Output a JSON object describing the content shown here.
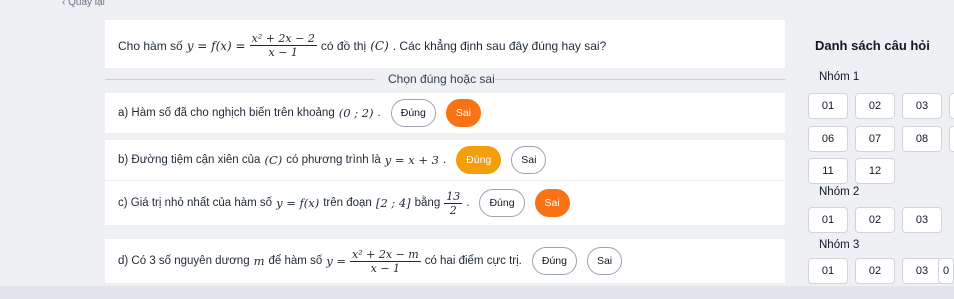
{
  "topbar": {
    "back_label": "Quay lại",
    "title": ""
  },
  "question": {
    "prefix": "Cho hàm số",
    "y_eq": "y = f(x) =",
    "frac_num": "x² + 2x − 2",
    "frac_den": "x − 1",
    "suffix": "có đồ thị",
    "graph": "(C)",
    "tail": ". Các khẳng định sau đây đúng hay sai?"
  },
  "instruction": "Chọn đúng hoặc sai",
  "statements": [
    {
      "text": "a) Hàm số đã cho nghịch biến trên khoảng",
      "math": "(0 ; 2)",
      "end": ".",
      "true_label": "Đúng",
      "false_label": "Sai",
      "selected": "Sai"
    },
    {
      "text": "b) Đường tiệm cận xiên của",
      "math": "(C)",
      "text2": "có phương trình là",
      "math2": "y = x + 3",
      "end": ".",
      "true_label": "Đúng",
      "false_label": "Sai",
      "selected": "Đúng"
    },
    {
      "text": "c) Giá trị nhỏ nhất của hàm số",
      "math": "y = f(x)",
      "text2": "trên đoạn",
      "math2": "[2 ; 4]",
      "text3": "bằng",
      "frac_num": "13",
      "frac_den": "2",
      "end": ".",
      "true_label": "Đúng",
      "false_label": "Sai",
      "selected": "Sai"
    },
    {
      "text": "d) Có 3 số nguyên dương",
      "math": "m",
      "text2": "để hàm số",
      "math2": "y =",
      "frac_num": "x² + 2x − m",
      "frac_den": "x − 1",
      "text3": "có hai điểm cực trị.",
      "true_label": "Đúng",
      "false_label": "Sai",
      "selected": ""
    }
  ],
  "sidebar": {
    "title": "Danh sách câu hỏi",
    "groups": [
      {
        "label": "Nhóm 1",
        "items": [
          "01",
          "02",
          "03",
          "",
          "06",
          "07",
          "08",
          "",
          "11",
          "12"
        ]
      },
      {
        "label": "Nhóm 2",
        "items": [
          "01",
          "02",
          "03"
        ]
      },
      {
        "label": "Nhóm 3",
        "items": [
          "01",
          "02",
          "03",
          "0"
        ]
      }
    ]
  }
}
